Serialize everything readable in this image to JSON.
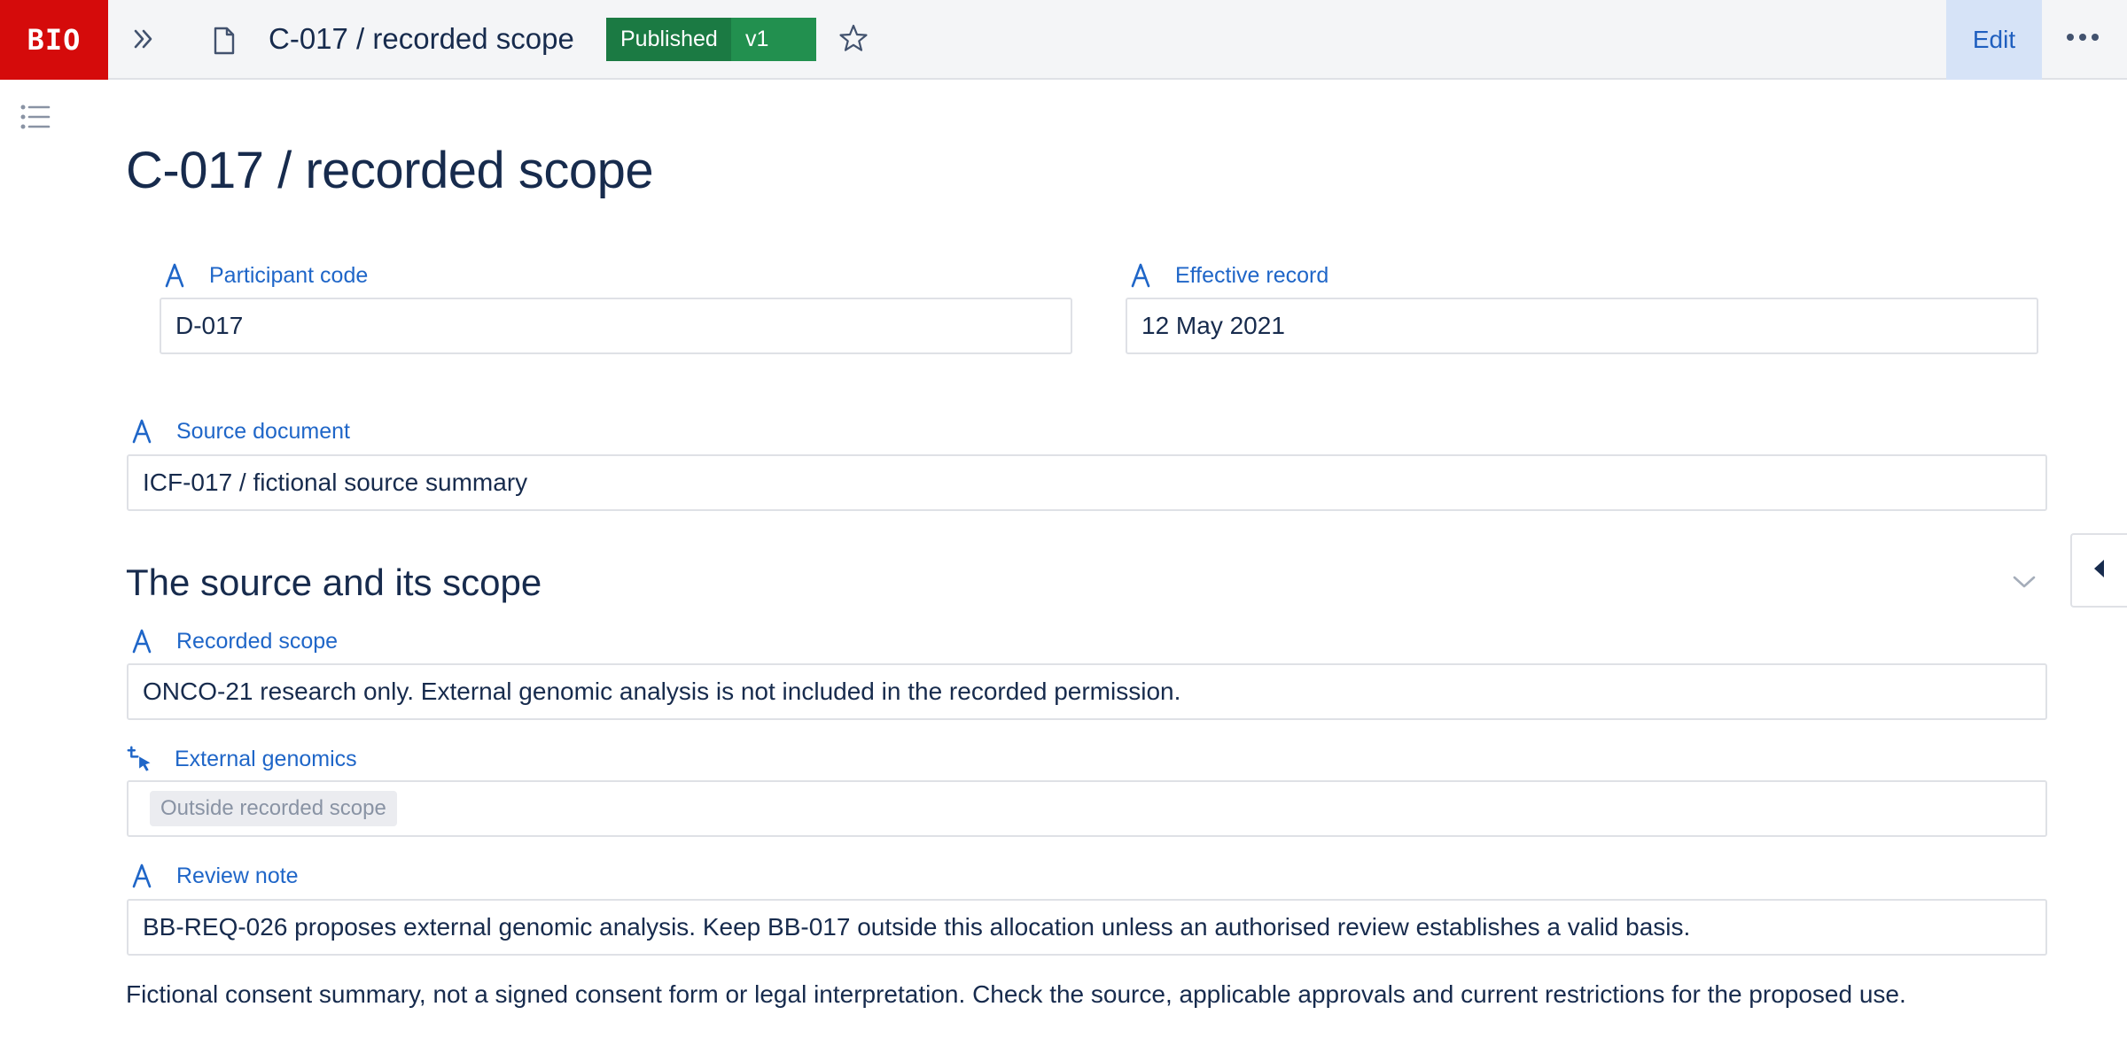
{
  "app": {
    "logo": "BIO"
  },
  "header": {
    "title": "C-017 / recorded scope",
    "status": "Published",
    "version": "v1",
    "edit_label": "Edit"
  },
  "page": {
    "title": "C-017 / recorded scope",
    "fields": {
      "participant_code": {
        "label": "Participant code",
        "value": "D-017"
      },
      "effective_record": {
        "label": "Effective record",
        "value": "12 May 2021"
      },
      "source_document": {
        "label": "Source document",
        "value": "ICF-017 / fictional source summary"
      }
    },
    "section": {
      "heading": "The source and its scope",
      "recorded_scope": {
        "label": "Recorded scope",
        "value": "ONCO-21 research only. External genomic analysis is not included in the recorded permission."
      },
      "external_genomics": {
        "label": "External genomics",
        "tag": "Outside recorded scope"
      },
      "review_note": {
        "label": "Review note",
        "value": "BB-REQ-026 proposes external genomic analysis. Keep BB-017 outside this allocation unless an authorised review establishes a valid basis."
      }
    },
    "footnote": "Fictional consent summary, not a signed consent form or legal interpretation. Check the source, applicable approvals and current restrictions for the proposed use."
  },
  "icons": {
    "expand": "double-chevron-right-icon",
    "page": "page-icon",
    "star": "star-icon",
    "more": "more-horizontal-icon",
    "toc": "table-of-contents-icon",
    "text_field": "text-field-icon",
    "select_field": "select-cursor-icon",
    "collapse_panel": "caret-left-icon",
    "section_toggle": "chevron-down-icon"
  },
  "colors": {
    "brand": "#d50b0b",
    "published": "#1b7a43",
    "version": "#22904f",
    "label": "#1f66c8",
    "edit_bg": "#d6e3f7"
  }
}
